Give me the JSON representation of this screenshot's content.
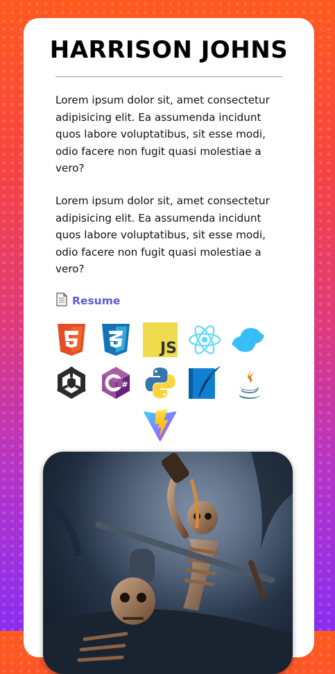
{
  "profile": {
    "name": "HARRISON JOHNS",
    "paragraphs": [
      "Lorem ipsum dolor sit, amet consectetur adipisicing elit. Ea assumenda incidunt quos labore voluptatibus, sit esse modi, odio facere non fugit quasi molestiae a vero?",
      "Lorem ipsum dolor sit, amet consectetur adipisicing elit. Ea assumenda incidunt quos labore voluptatibus, sit esse modi, odio facere non fugit quasi molestiae a vero?"
    ],
    "resume_label": "Resume"
  },
  "tech_icons": [
    {
      "icon": "html5-icon"
    },
    {
      "icon": "css3-icon"
    },
    {
      "icon": "javascript-icon",
      "text": "JS"
    },
    {
      "icon": "react-icon"
    },
    {
      "icon": "tailwind-icon"
    },
    {
      "icon": "unity-icon"
    },
    {
      "icon": "csharp-icon",
      "text": "C#"
    },
    {
      "icon": "python-icon"
    },
    {
      "icon": "feather-icon"
    },
    {
      "icon": "java-icon"
    },
    {
      "icon": "vite-icon"
    }
  ],
  "image": {
    "icon": "skeleton-artwork-image"
  },
  "colors": {
    "background_top": "#ff5a1f",
    "background_bottom": "#8a2ef0",
    "card": "#ffffff",
    "link": "#5b5bd6"
  }
}
